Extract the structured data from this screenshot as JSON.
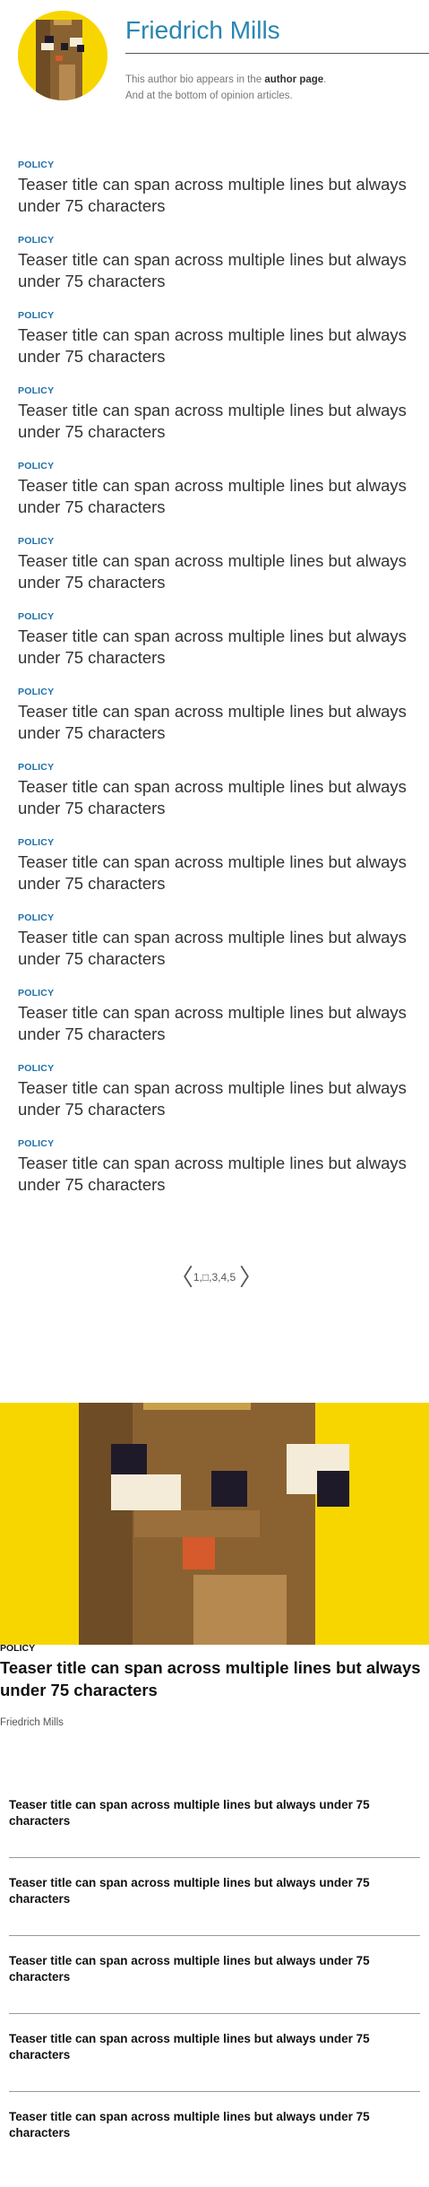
{
  "author": {
    "name": "Friedrich Mills",
    "bio_prefix": "This author bio appears in the ",
    "bio_link": "author page",
    "bio_suffix": ".",
    "bio_line2": "And at the bottom of opinion articles."
  },
  "teasers": [
    {
      "kicker": "POLICY",
      "title": "Teaser title can span across multiple lines but always under 75 characters"
    },
    {
      "kicker": "POLICY",
      "title": "Teaser title can span across multiple lines but always under 75 characters"
    },
    {
      "kicker": "POLICY",
      "title": "Teaser title can span across multiple lines but always under 75 characters"
    },
    {
      "kicker": "POLICY",
      "title": "Teaser title can span across multiple lines but always under 75 characters"
    },
    {
      "kicker": "POLICY",
      "title": "Teaser title can span across multiple lines but always under 75 characters"
    },
    {
      "kicker": "POLICY",
      "title": "Teaser title can span across multiple lines but always under 75 characters"
    },
    {
      "kicker": "POLICY",
      "title": "Teaser title can span across multiple lines but always under 75 characters"
    },
    {
      "kicker": "POLICY",
      "title": "Teaser title can span across multiple lines but always under 75 characters"
    },
    {
      "kicker": "POLICY",
      "title": "Teaser title can span across multiple lines but always under 75 characters"
    },
    {
      "kicker": "POLICY",
      "title": "Teaser title can span across multiple lines but always under 75 characters"
    },
    {
      "kicker": "POLICY",
      "title": "Teaser title can span across multiple lines but always under 75 characters"
    },
    {
      "kicker": "POLICY",
      "title": "Teaser title can span across multiple lines but always under 75 characters"
    },
    {
      "kicker": "POLICY",
      "title": "Teaser title can span across multiple lines but always under 75 characters"
    },
    {
      "kicker": "POLICY",
      "title": "Teaser title can span across multiple lines but always under 75 characters"
    }
  ],
  "pagination": {
    "prev_icon": "chevron-left-icon",
    "next_icon": "chevron-right-icon",
    "pages": "1,□,3,4,5"
  },
  "featured": {
    "kicker": "POLICY",
    "title": "Teaser title can span across multiple lines but always under 75 characters",
    "author": "Friedrich Mills"
  },
  "small_teasers": [
    {
      "title": "Teaser title can span across multiple lines but always under 75 characters"
    },
    {
      "title": "Teaser title can span across multiple lines but always under 75 characters"
    },
    {
      "title": "Teaser title can span across multiple lines but always under 75 characters"
    },
    {
      "title": "Teaser title can span across multiple lines but always under 75 characters"
    },
    {
      "title": "Teaser title can span across multiple lines but always under 75 characters"
    }
  ],
  "colors": {
    "accent": "#2a86b0",
    "kicker": "#1d6fa8",
    "avatar_bg": "#f7d600"
  }
}
